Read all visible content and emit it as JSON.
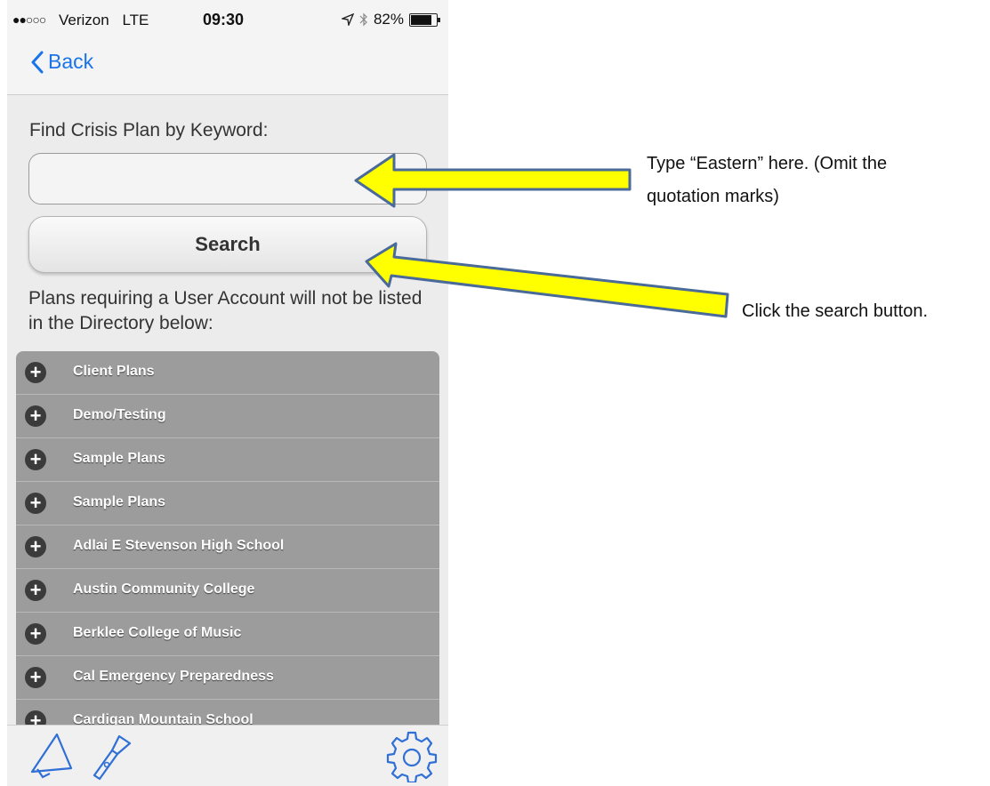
{
  "status_bar": {
    "signal": "●●○○○",
    "carrier": "Verizon",
    "network": "LTE",
    "time": "09:30",
    "battery": "82%"
  },
  "nav": {
    "back_label": "Back"
  },
  "form": {
    "find_label": "Find Crisis Plan by Keyword:",
    "search_value": "",
    "search_placeholder": "",
    "search_button_label": "Search",
    "note": "Plans requiring a User Account will not be listed in the Directory below:"
  },
  "directory": {
    "items": [
      {
        "label": "Client Plans"
      },
      {
        "label": "Demo/Testing"
      },
      {
        "label": "Sample Plans"
      },
      {
        "label": "Sample Plans"
      },
      {
        "label": "Adlai E Stevenson High School"
      },
      {
        "label": "Austin Community College"
      },
      {
        "label": "Berklee College of Music"
      },
      {
        "label": "Cal Emergency Preparedness"
      },
      {
        "label": "Cardigan Mountain School"
      }
    ]
  },
  "toolbar": {
    "icons": [
      "megaphone-icon",
      "flashlight-icon",
      "gear-icon"
    ]
  },
  "annotations": {
    "type_instruction": "Type “Eastern” here. (Omit the quotation marks)",
    "click_instruction": "Click the search button."
  },
  "colors": {
    "accent_blue": "#1a73e8",
    "arrow_fill": "#ffff00",
    "arrow_stroke": "#4a6a9a",
    "directory_bg": "#9c9c9c"
  }
}
